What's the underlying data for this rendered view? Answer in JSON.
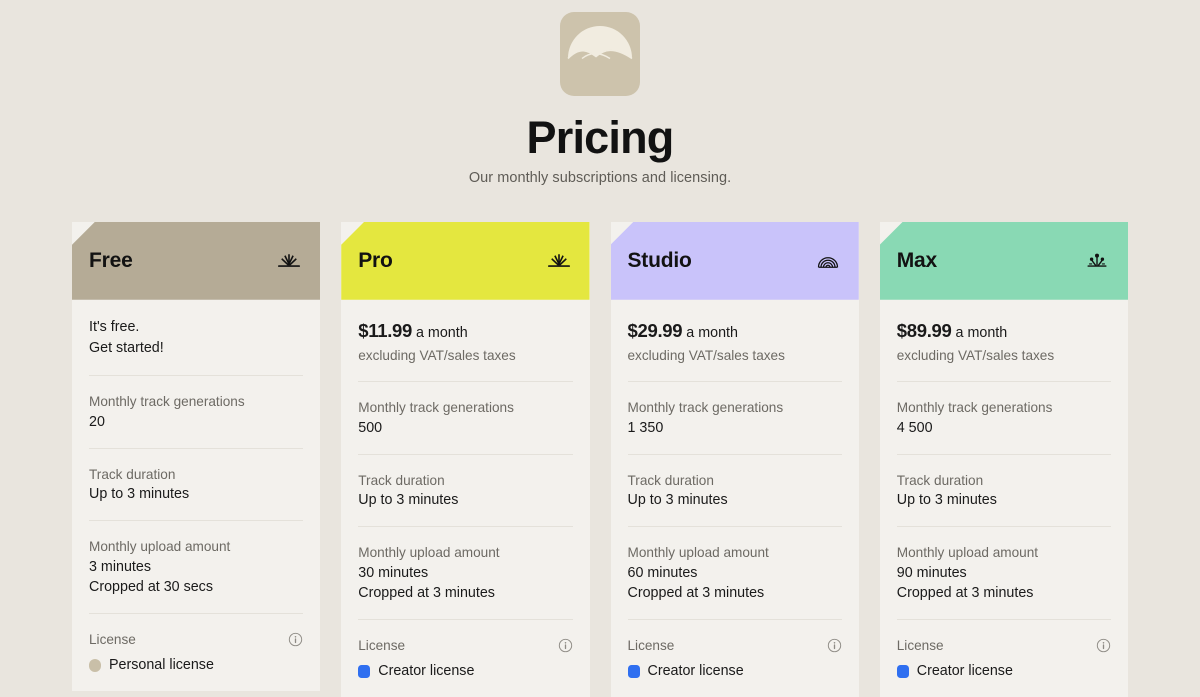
{
  "header": {
    "logo_icon": "sunrise-dome-logo",
    "title": "Pricing",
    "subtitle": "Our monthly subscriptions and licensing."
  },
  "labels": {
    "monthly_track_generations": "Monthly track generations",
    "track_duration": "Track duration",
    "monthly_upload_amount": "Monthly upload amount",
    "license": "License",
    "per_month": "a month",
    "tax_note": "excluding VAT/sales taxes",
    "info_icon": "info-icon"
  },
  "plans": [
    {
      "name": "Free",
      "header_color": "#b5ab96",
      "icon": "sunburst-icon",
      "price_free_line1": "It's free.",
      "price_free_line2": "Get started!",
      "generations": "20",
      "duration": "Up to 3 minutes",
      "upload_amount": "3 minutes",
      "upload_crop": "Cropped at 30 secs",
      "license_type": "Personal license",
      "license_color": "#c9bfa8"
    },
    {
      "name": "Pro",
      "header_color": "#e4e73f",
      "icon": "sunburst-icon",
      "price": "$11.99",
      "generations": "500",
      "duration": "Up to 3 minutes",
      "upload_amount": "30 minutes",
      "upload_crop": "Cropped at 3 minutes",
      "license_type": "Creator license",
      "license_color": "#2f6ff0"
    },
    {
      "name": "Studio",
      "header_color": "#c9c3fa",
      "icon": "rainbow-arc-icon",
      "price": "$29.99",
      "generations": "1 350",
      "duration": "Up to 3 minutes",
      "upload_amount": "60 minutes",
      "upload_crop": "Cropped at 3 minutes",
      "license_type": "Creator license",
      "license_color": "#2f6ff0"
    },
    {
      "name": "Max",
      "header_color": "#89d9b4",
      "icon": "starburst-icon",
      "price": "$89.99",
      "generations": "4 500",
      "duration": "Up to 3 minutes",
      "upload_amount": "90 minutes",
      "upload_crop": "Cropped at 3 minutes",
      "license_type": "Creator license",
      "license_color": "#2f6ff0"
    }
  ]
}
